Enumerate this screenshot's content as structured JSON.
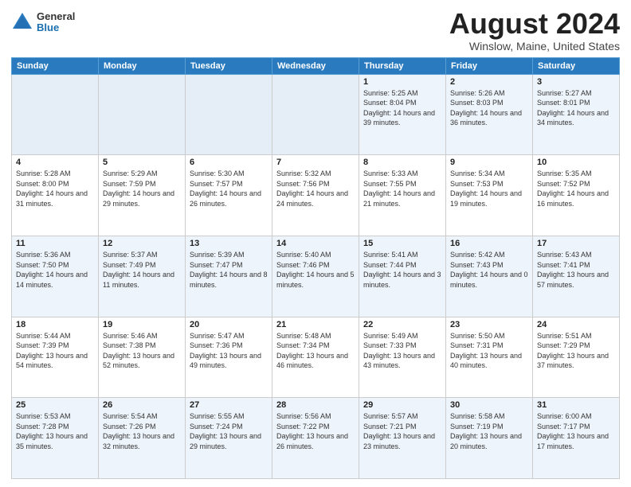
{
  "header": {
    "logo_general": "General",
    "logo_blue": "Blue",
    "month_title": "August 2024",
    "location": "Winslow, Maine, United States"
  },
  "days_of_week": [
    "Sunday",
    "Monday",
    "Tuesday",
    "Wednesday",
    "Thursday",
    "Friday",
    "Saturday"
  ],
  "weeks": [
    [
      {
        "day": "",
        "info": ""
      },
      {
        "day": "",
        "info": ""
      },
      {
        "day": "",
        "info": ""
      },
      {
        "day": "",
        "info": ""
      },
      {
        "day": "1",
        "info": "Sunrise: 5:25 AM\nSunset: 8:04 PM\nDaylight: 14 hours\nand 39 minutes."
      },
      {
        "day": "2",
        "info": "Sunrise: 5:26 AM\nSunset: 8:03 PM\nDaylight: 14 hours\nand 36 minutes."
      },
      {
        "day": "3",
        "info": "Sunrise: 5:27 AM\nSunset: 8:01 PM\nDaylight: 14 hours\nand 34 minutes."
      }
    ],
    [
      {
        "day": "4",
        "info": "Sunrise: 5:28 AM\nSunset: 8:00 PM\nDaylight: 14 hours\nand 31 minutes."
      },
      {
        "day": "5",
        "info": "Sunrise: 5:29 AM\nSunset: 7:59 PM\nDaylight: 14 hours\nand 29 minutes."
      },
      {
        "day": "6",
        "info": "Sunrise: 5:30 AM\nSunset: 7:57 PM\nDaylight: 14 hours\nand 26 minutes."
      },
      {
        "day": "7",
        "info": "Sunrise: 5:32 AM\nSunset: 7:56 PM\nDaylight: 14 hours\nand 24 minutes."
      },
      {
        "day": "8",
        "info": "Sunrise: 5:33 AM\nSunset: 7:55 PM\nDaylight: 14 hours\nand 21 minutes."
      },
      {
        "day": "9",
        "info": "Sunrise: 5:34 AM\nSunset: 7:53 PM\nDaylight: 14 hours\nand 19 minutes."
      },
      {
        "day": "10",
        "info": "Sunrise: 5:35 AM\nSunset: 7:52 PM\nDaylight: 14 hours\nand 16 minutes."
      }
    ],
    [
      {
        "day": "11",
        "info": "Sunrise: 5:36 AM\nSunset: 7:50 PM\nDaylight: 14 hours\nand 14 minutes."
      },
      {
        "day": "12",
        "info": "Sunrise: 5:37 AM\nSunset: 7:49 PM\nDaylight: 14 hours\nand 11 minutes."
      },
      {
        "day": "13",
        "info": "Sunrise: 5:39 AM\nSunset: 7:47 PM\nDaylight: 14 hours\nand 8 minutes."
      },
      {
        "day": "14",
        "info": "Sunrise: 5:40 AM\nSunset: 7:46 PM\nDaylight: 14 hours\nand 5 minutes."
      },
      {
        "day": "15",
        "info": "Sunrise: 5:41 AM\nSunset: 7:44 PM\nDaylight: 14 hours\nand 3 minutes."
      },
      {
        "day": "16",
        "info": "Sunrise: 5:42 AM\nSunset: 7:43 PM\nDaylight: 14 hours\nand 0 minutes."
      },
      {
        "day": "17",
        "info": "Sunrise: 5:43 AM\nSunset: 7:41 PM\nDaylight: 13 hours\nand 57 minutes."
      }
    ],
    [
      {
        "day": "18",
        "info": "Sunrise: 5:44 AM\nSunset: 7:39 PM\nDaylight: 13 hours\nand 54 minutes."
      },
      {
        "day": "19",
        "info": "Sunrise: 5:46 AM\nSunset: 7:38 PM\nDaylight: 13 hours\nand 52 minutes."
      },
      {
        "day": "20",
        "info": "Sunrise: 5:47 AM\nSunset: 7:36 PM\nDaylight: 13 hours\nand 49 minutes."
      },
      {
        "day": "21",
        "info": "Sunrise: 5:48 AM\nSunset: 7:34 PM\nDaylight: 13 hours\nand 46 minutes."
      },
      {
        "day": "22",
        "info": "Sunrise: 5:49 AM\nSunset: 7:33 PM\nDaylight: 13 hours\nand 43 minutes."
      },
      {
        "day": "23",
        "info": "Sunrise: 5:50 AM\nSunset: 7:31 PM\nDaylight: 13 hours\nand 40 minutes."
      },
      {
        "day": "24",
        "info": "Sunrise: 5:51 AM\nSunset: 7:29 PM\nDaylight: 13 hours\nand 37 minutes."
      }
    ],
    [
      {
        "day": "25",
        "info": "Sunrise: 5:53 AM\nSunset: 7:28 PM\nDaylight: 13 hours\nand 35 minutes."
      },
      {
        "day": "26",
        "info": "Sunrise: 5:54 AM\nSunset: 7:26 PM\nDaylight: 13 hours\nand 32 minutes."
      },
      {
        "day": "27",
        "info": "Sunrise: 5:55 AM\nSunset: 7:24 PM\nDaylight: 13 hours\nand 29 minutes."
      },
      {
        "day": "28",
        "info": "Sunrise: 5:56 AM\nSunset: 7:22 PM\nDaylight: 13 hours\nand 26 minutes."
      },
      {
        "day": "29",
        "info": "Sunrise: 5:57 AM\nSunset: 7:21 PM\nDaylight: 13 hours\nand 23 minutes."
      },
      {
        "day": "30",
        "info": "Sunrise: 5:58 AM\nSunset: 7:19 PM\nDaylight: 13 hours\nand 20 minutes."
      },
      {
        "day": "31",
        "info": "Sunrise: 6:00 AM\nSunset: 7:17 PM\nDaylight: 13 hours\nand 17 minutes."
      }
    ]
  ]
}
